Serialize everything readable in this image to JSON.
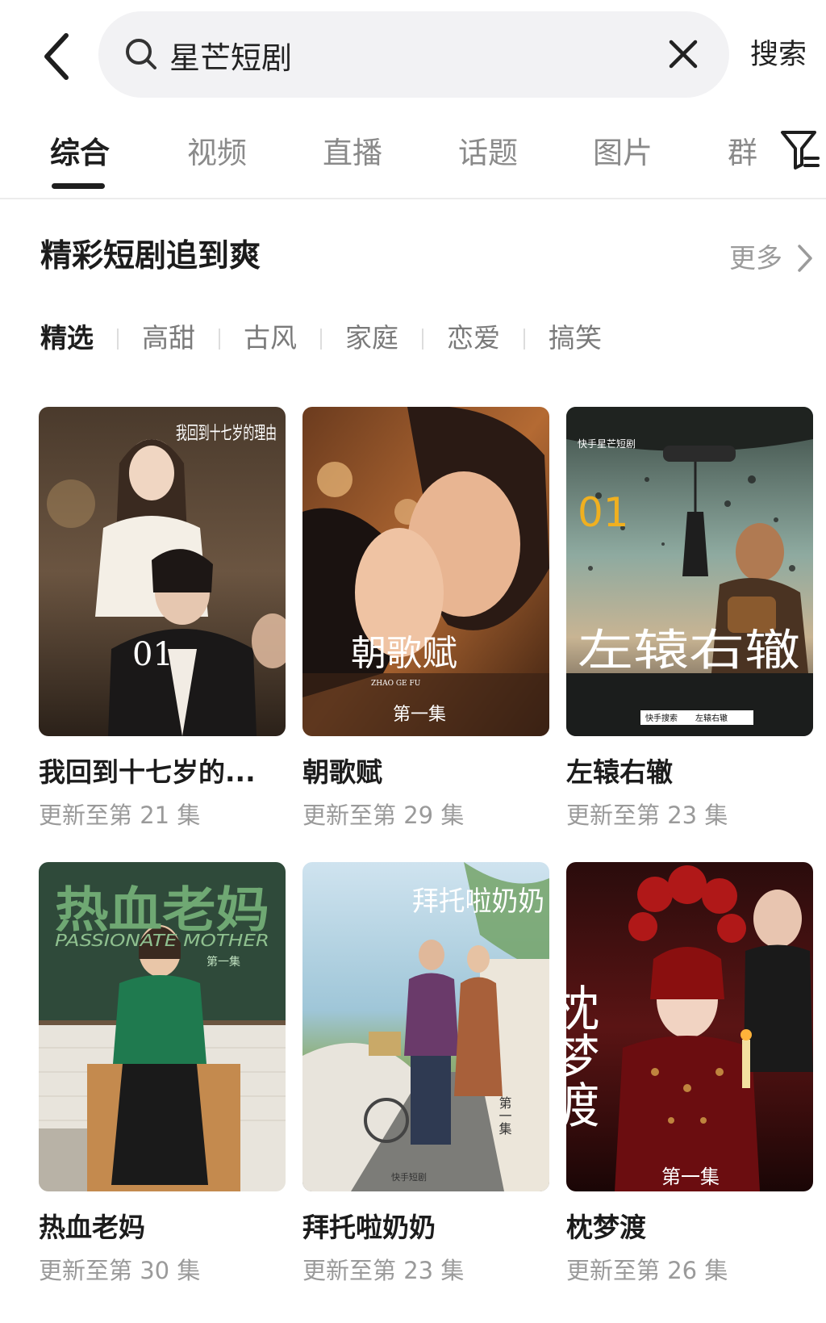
{
  "search": {
    "query": "星芒短剧",
    "submit_label": "搜索"
  },
  "tabs": [
    {
      "label": "综合",
      "active": true
    },
    {
      "label": "视频"
    },
    {
      "label": "直播"
    },
    {
      "label": "话题"
    },
    {
      "label": "图片"
    },
    {
      "label": "群"
    }
  ],
  "section": {
    "title": "精彩短剧追到爽",
    "more_label": "更多"
  },
  "categories": [
    {
      "label": "精选",
      "active": true
    },
    {
      "label": "高甜"
    },
    {
      "label": "古风"
    },
    {
      "label": "家庭"
    },
    {
      "label": "恋爱"
    },
    {
      "label": "搞笑"
    }
  ],
  "dramas": [
    {
      "title": "我回到十七岁的...",
      "update": "更新至第 21 集",
      "poster_text": "我回到十七岁的理由",
      "poster_num": "01"
    },
    {
      "title": "朝歌赋",
      "update": "更新至第 29 集",
      "poster_text": "朝歌赋",
      "poster_sub": "ZHAO GE FU",
      "poster_ep": "第一集"
    },
    {
      "title": "左辕右辙",
      "update": "更新至第 23 集",
      "poster_text": "左辕右辙",
      "poster_num": "01",
      "poster_brand": "快手星芒短剧",
      "poster_search": "快手搜索",
      "poster_search_q": "左辕右辙"
    },
    {
      "title": "热血老妈",
      "update": "更新至第 30 集",
      "poster_text": "热血老妈",
      "poster_sub": "PASSIONATE MOTHER",
      "poster_ep": "第一集"
    },
    {
      "title": "拜托啦奶奶",
      "update": "更新至第 23 集",
      "poster_text": "拜托啦奶奶",
      "poster_ep": "第一集",
      "poster_brand": "快手短剧"
    },
    {
      "title": "枕梦渡",
      "update": "更新至第 26 集",
      "poster_text": "枕梦渡",
      "poster_ep": "第一集"
    }
  ],
  "colors": {
    "accent": "#1e1e1e",
    "muted": "#9a9a9a",
    "search_bg": "#f2f2f4"
  }
}
